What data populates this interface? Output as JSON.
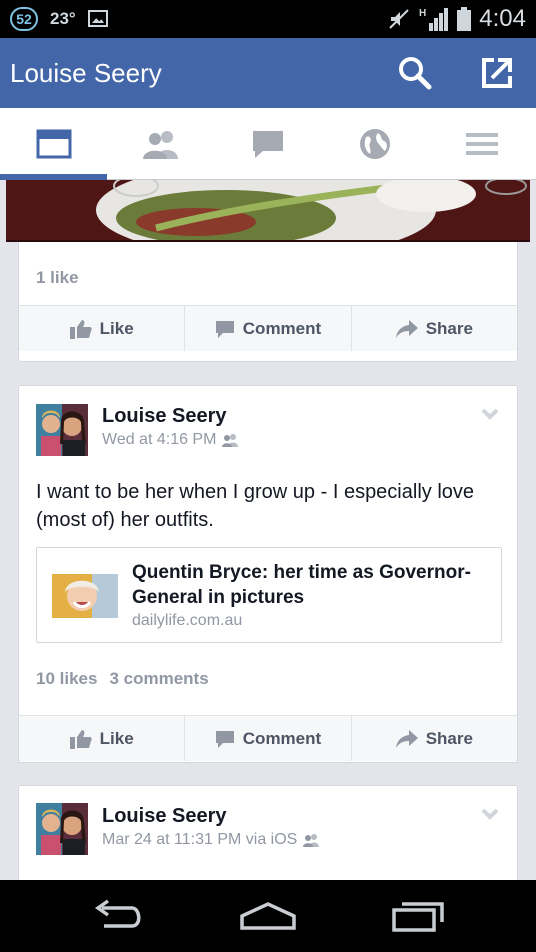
{
  "status_bar": {
    "badge": "52",
    "temperature": "23°",
    "time": "4:04",
    "network": "H"
  },
  "app_bar": {
    "title": "Louise Seery"
  },
  "tabs": [
    {
      "name": "news-feed",
      "active": true
    },
    {
      "name": "friends",
      "active": false
    },
    {
      "name": "messages",
      "active": false
    },
    {
      "name": "notifications",
      "active": false
    },
    {
      "name": "more",
      "active": false
    }
  ],
  "previous_post": {
    "likes": "1 like"
  },
  "actions": {
    "like": "Like",
    "comment": "Comment",
    "share": "Share"
  },
  "post_1": {
    "author": "Louise Seery",
    "time": "Wed at 4:16 PM",
    "text": "I want to be her when I grow up - I especially love (most of) her outfits.",
    "link": {
      "title": "Quentin Bryce: her time as Governor-General in pictures",
      "domain": "dailylife.com.au"
    },
    "likes": "10 likes",
    "comments": "3 comments"
  },
  "post_2": {
    "author": "Louise Seery",
    "time": "Mar 24 at 11:31 PM via iOS"
  },
  "colors": {
    "brand_blue": "#4366a9",
    "feed_bg": "#e3e5ea",
    "muted_text": "#9197a3"
  }
}
